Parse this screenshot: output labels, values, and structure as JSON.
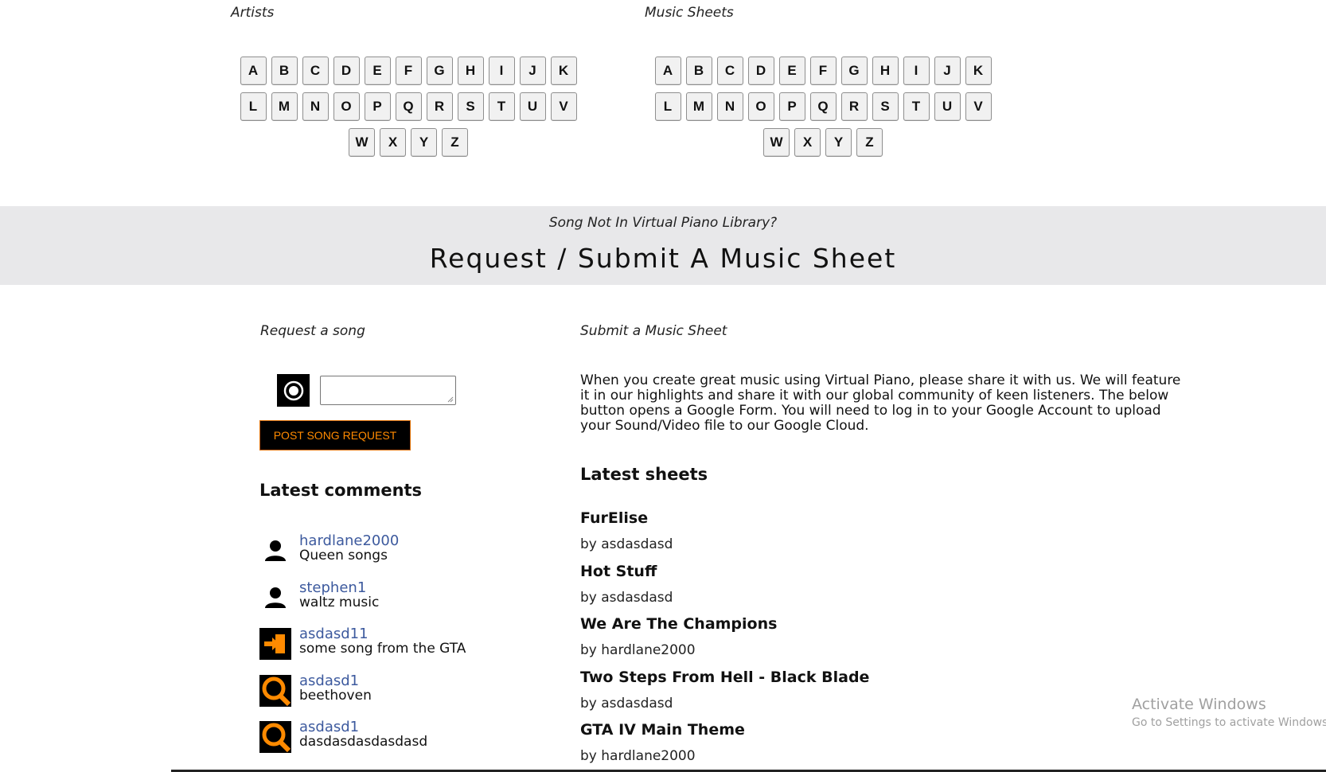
{
  "artists": {
    "label": "Artists",
    "letters": [
      "A",
      "B",
      "C",
      "D",
      "E",
      "F",
      "G",
      "H",
      "I",
      "J",
      "K",
      "L",
      "M",
      "N",
      "O",
      "P",
      "Q",
      "R",
      "S",
      "T",
      "U",
      "V",
      "W",
      "X",
      "Y",
      "Z"
    ]
  },
  "music_sheets": {
    "label": "Music Sheets",
    "letters": [
      "A",
      "B",
      "C",
      "D",
      "E",
      "F",
      "G",
      "H",
      "I",
      "J",
      "K",
      "L",
      "M",
      "N",
      "O",
      "P",
      "Q",
      "R",
      "S",
      "T",
      "U",
      "V",
      "W",
      "X",
      "Y",
      "Z"
    ]
  },
  "banner": {
    "subtitle": "Song Not In Virtual Piano Library?",
    "title": "Request / Submit A Music Sheet"
  },
  "request": {
    "heading": "Request a song",
    "button_label": "POST SONG REQUEST"
  },
  "submit": {
    "heading": "Submit a Music Sheet",
    "description": "When you create great music using Virtual Piano, please share it with us. We will feature it in our highlights and share it with our global community of keen listeners. The below button opens a Google Form. You will need to log in to your Google Account to upload your Sound/Video file to our Google Cloud."
  },
  "latest_comments": {
    "heading": "Latest comments",
    "items": [
      {
        "user": "hardlane2000",
        "text": "Queen songs",
        "avatar": "person-icon"
      },
      {
        "user": "stephen1",
        "text": "waltz music",
        "avatar": "person-icon"
      },
      {
        "user": "asdasd11",
        "text": "some song from the GTA",
        "avatar": "login-icon"
      },
      {
        "user": "asdasd1",
        "text": "beethoven",
        "avatar": "magnifier-icon"
      },
      {
        "user": "asdasd1",
        "text": "dasdasdasdasdasd",
        "avatar": "magnifier-icon"
      }
    ]
  },
  "latest_sheets": {
    "heading": "Latest sheets",
    "items": [
      {
        "title": "FurElise",
        "by": "by asdasdasd"
      },
      {
        "title": "Hot Stuff",
        "by": "by asdasdasd"
      },
      {
        "title": "We Are The Champions",
        "by": "by hardlane2000"
      },
      {
        "title": "Two Steps From Hell - Black Blade",
        "by": "by asdasdasd"
      },
      {
        "title": "GTA IV Main Theme",
        "by": "by hardlane2000"
      }
    ]
  },
  "watermark": {
    "title": "Activate Windows",
    "subtitle": "Go to Settings to activate Windows."
  },
  "colors": {
    "banner_bg": "#e8e8ea",
    "link": "#3d5a9e",
    "accent_orange": "#ff8a00"
  }
}
